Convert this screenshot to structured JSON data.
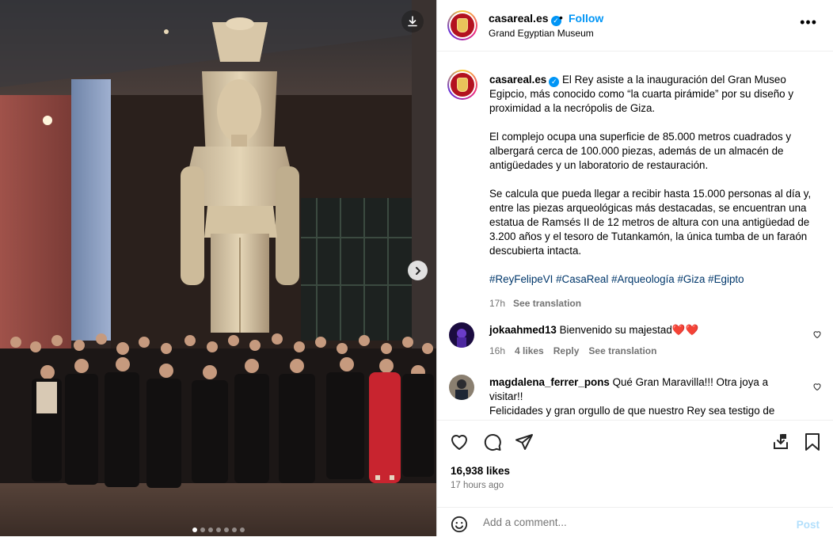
{
  "post_image": {
    "alt": "",
    "carousel_count": 7,
    "carousel_active_index": 0
  },
  "header": {
    "username": "casareal.es",
    "separator": "•",
    "follow_label": "Follow",
    "location": "Grand Egyptian Museum",
    "more_label": "•••"
  },
  "caption": {
    "username": "casareal.es",
    "paragraphs": [
      "El Rey asiste a la inauguración del Gran Museo Egipcio, más conocido como “la cuarta pirámide” por su diseño y proximidad a la necrópolis de Giza.",
      "El complejo ocupa una superficie de 85.000 metros cuadrados y albergará cerca de 100.000 piezas, además de un almacén de antigüedades y un laboratorio de restauración.",
      "Se calcula que pueda llegar a recibir hasta 15.000 personas al día y, entre las piezas arqueológicas más destacadas, se encuentran una estatua de Ramsés II de 12 metros de altura con una antigüedad de 3.200 años y el tesoro de Tutankamón, la única tumba de un faraón descubierta intacta."
    ],
    "hashtags": "#ReyFelipeVI #CasaReal #Arqueología #Giza #Egipto",
    "time": "17h",
    "see_translation": "See translation"
  },
  "comments": [
    {
      "username": "jokaahmed13",
      "text": "Bienvenido su majestad❤️❤️",
      "time": "16h",
      "likes": "4 likes",
      "reply": "Reply",
      "see_translation": "See translation"
    },
    {
      "username": "magdalena_ferrer_pons",
      "text": "Qué Gran Maravilla!!! Otra joya a visitar!!",
      "text2": "Felicidades y gran orgullo de que nuestro Rey sea testigo de"
    }
  ],
  "stats": {
    "likes": "16,938 likes",
    "ago": "17 hours ago"
  },
  "add_comment": {
    "placeholder": "Add a comment...",
    "post_label": "Post"
  },
  "colors": {
    "accent": "#0095f6",
    "hashtag": "#00376b",
    "muted": "#737373",
    "post_disabled": "#b2dffc"
  },
  "icons": {
    "download": "download-icon",
    "next": "chevron-right-icon",
    "verified": "verified-badge-icon",
    "like": "heart-icon",
    "comment": "comment-icon",
    "share": "share-icon",
    "save": "bookmark-icon",
    "emoji": "emoji-icon"
  }
}
